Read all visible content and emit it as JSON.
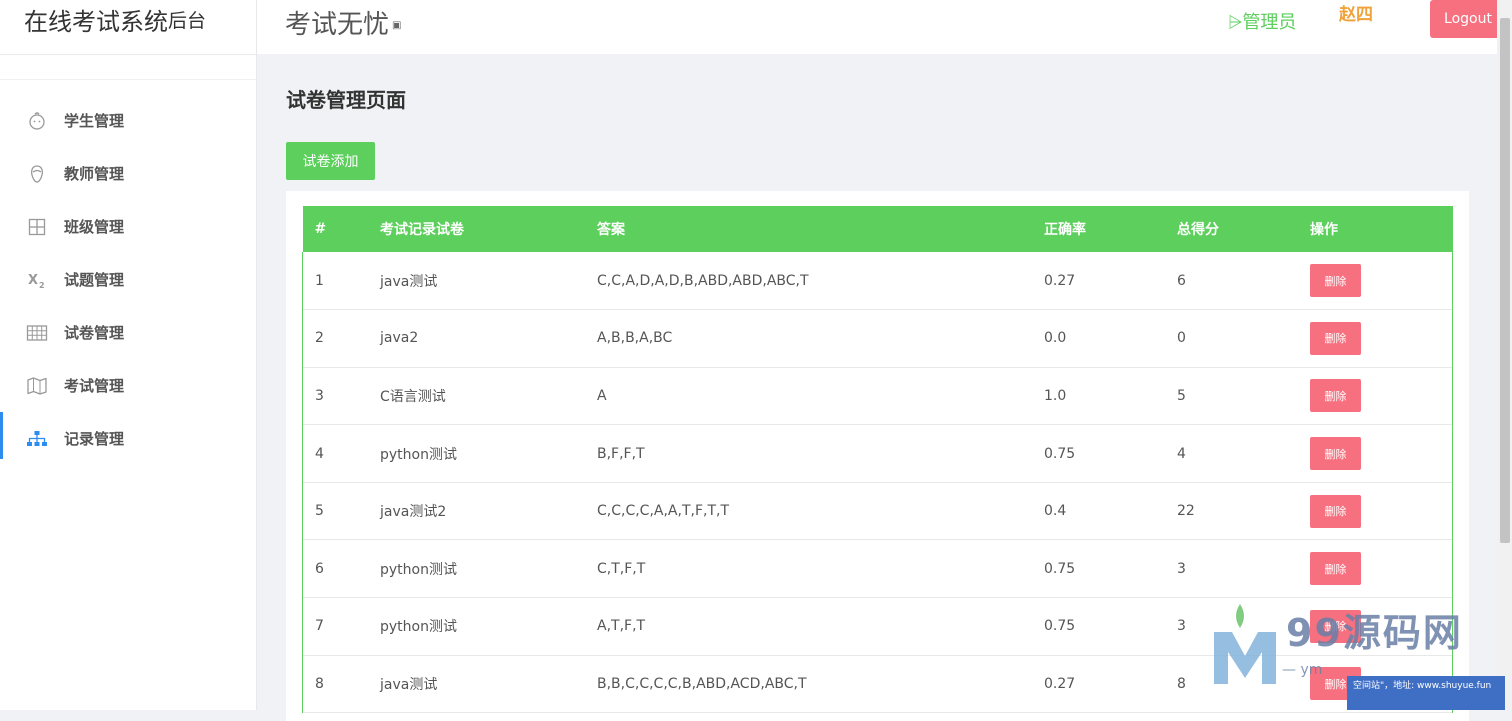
{
  "brand": {
    "title": "在线考试系统",
    "sub": "后台"
  },
  "header": {
    "title": "考试无忧",
    "title_sup": "▣",
    "role": "⩥管理员",
    "username": "赵四",
    "logout_label": "Logout"
  },
  "sidebar": {
    "items": [
      {
        "label": "学生管理",
        "icon": "student-icon"
      },
      {
        "label": "教师管理",
        "icon": "teacher-icon"
      },
      {
        "label": "班级管理",
        "icon": "class-grid-icon"
      },
      {
        "label": "试题管理",
        "icon": "subscript-icon"
      },
      {
        "label": "试卷管理",
        "icon": "table-icon"
      },
      {
        "label": "考试管理",
        "icon": "map-icon"
      },
      {
        "label": "记录管理",
        "icon": "sitemap-icon",
        "active": true
      }
    ]
  },
  "main": {
    "page_title": "试卷管理页面",
    "add_label": "试卷添加",
    "table": {
      "headers": [
        "#",
        "考试记录试卷",
        "答案",
        "正确率",
        "总得分",
        "操作"
      ],
      "delete_label": "删除",
      "rows": [
        [
          "1",
          "java测试",
          "C,C,A,D,A,D,B,ABD,ABD,ABC,T",
          "0.27",
          "6"
        ],
        [
          "2",
          "java2",
          "A,B,B,A,BC",
          "0.0",
          "0"
        ],
        [
          "3",
          "C语言测试",
          "A",
          "1.0",
          "5"
        ],
        [
          "4",
          "python测试",
          "B,F,F,T",
          "0.75",
          "4"
        ],
        [
          "5",
          "java测试2",
          "C,C,C,C,A,A,T,F,T,T",
          "0.4",
          "22"
        ],
        [
          "6",
          "python测试",
          "C,T,F,T",
          "0.75",
          "3"
        ],
        [
          "7",
          "python测试",
          "A,T,F,T",
          "0.75",
          "3"
        ],
        [
          "8",
          "java测试",
          "B,B,C,C,C,C,B,ABD,ACD,ABC,T",
          "0.27",
          "8"
        ]
      ]
    }
  },
  "watermark": {
    "big": "99源码网",
    "line": "— ym",
    "bar": "空间站\"，地址: www.shuyue.fun"
  },
  "colors": {
    "green": "#5ccf5c",
    "red": "#f7707f",
    "orange": "#f0a23a",
    "blue": "#2d8cf0"
  }
}
